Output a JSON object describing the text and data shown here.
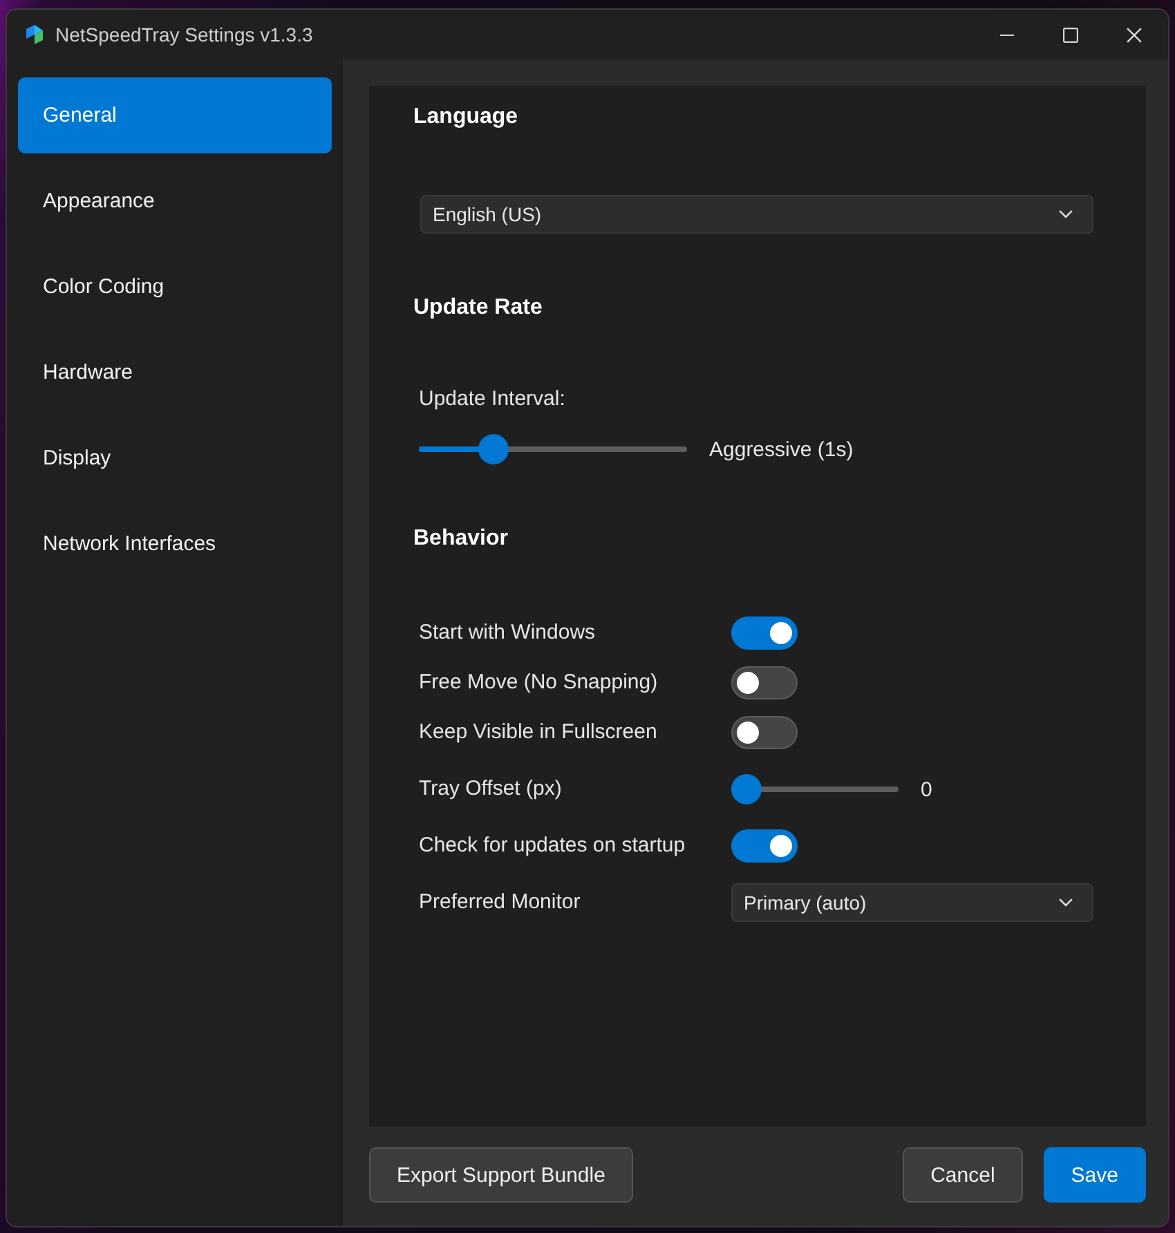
{
  "window": {
    "title": "NetSpeedTray Settings v1.3.3"
  },
  "sidebar": {
    "items": [
      {
        "label": "General",
        "selected": true
      },
      {
        "label": "Appearance",
        "selected": false
      },
      {
        "label": "Color Coding",
        "selected": false
      },
      {
        "label": "Hardware",
        "selected": false
      },
      {
        "label": "Display",
        "selected": false
      },
      {
        "label": "Network Interfaces",
        "selected": false
      }
    ]
  },
  "sections": [
    {
      "title": "Language",
      "items": [
        {
          "kind": "dropdown",
          "value": "English (US)"
        }
      ]
    },
    {
      "title": "Update Rate",
      "items": [
        {
          "kind": "labeled_slider",
          "label": "Update Interval:",
          "level": 0.25,
          "reading": "Aggressive (1s)"
        }
      ]
    },
    {
      "title": "Behavior",
      "items": [
        {
          "kind": "toggle",
          "label": "Start with Windows",
          "on": true
        },
        {
          "kind": "toggle",
          "label": "Free Move (No Snapping)",
          "on": false
        },
        {
          "kind": "toggle",
          "label": "Keep Visible in Fullscreen",
          "on": false
        },
        {
          "kind": "slider",
          "label": "Tray Offset (px)",
          "level": 0,
          "reading": "0"
        },
        {
          "kind": "toggle",
          "label": "Check for updates on startup",
          "on": true
        },
        {
          "kind": "dropdown",
          "label": "Preferred Monitor",
          "value": "Primary (auto)"
        }
      ]
    }
  ],
  "footer": {
    "left": [
      {
        "label": "Export Support Bundle",
        "primary": false
      }
    ],
    "right": [
      {
        "label": "Cancel",
        "primary": false
      },
      {
        "label": "Save",
        "primary": true
      }
    ]
  }
}
